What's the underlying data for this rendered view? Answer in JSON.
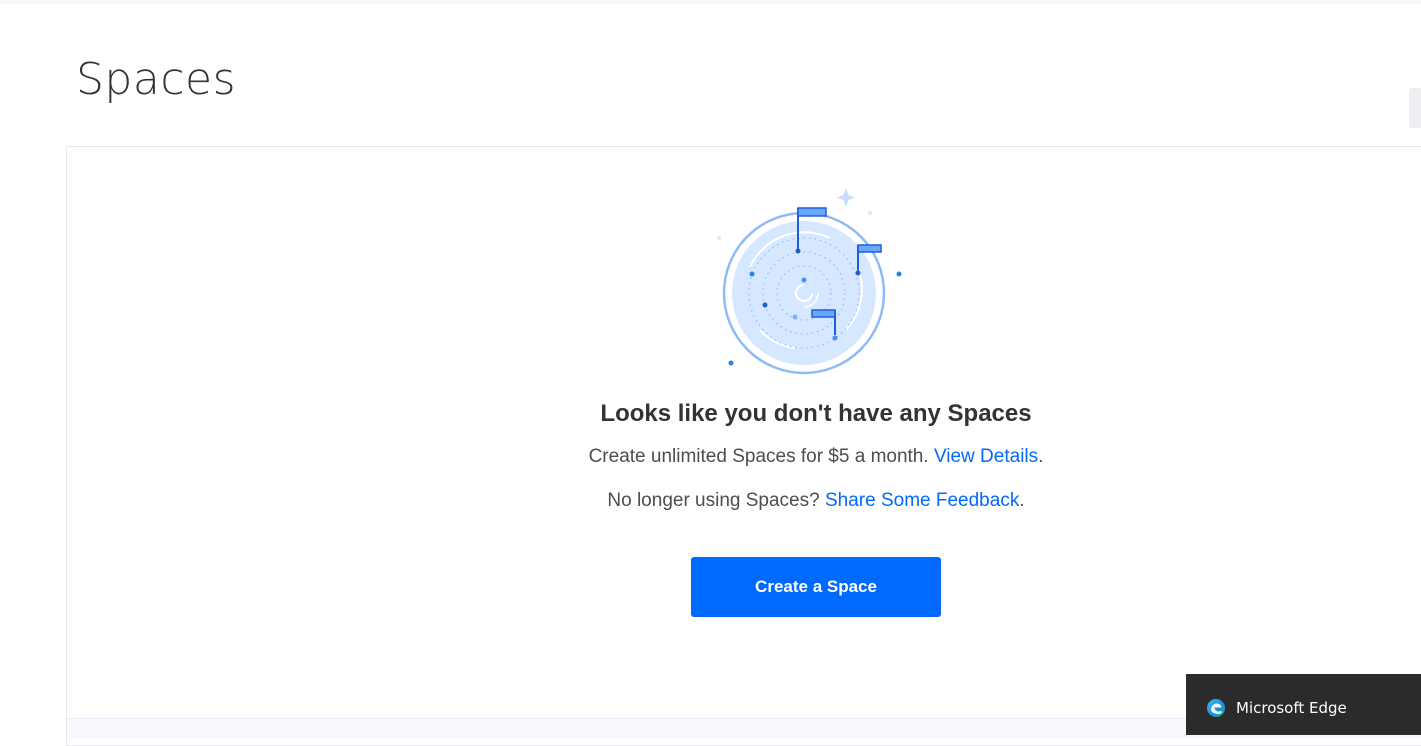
{
  "page": {
    "title": "Spaces"
  },
  "empty_state": {
    "illustration_icon": "radar-flags-icon",
    "heading": "Looks like you don't have any Spaces",
    "line1_text": "Create unlimited Spaces for $5 a month.",
    "line1_link": "View Details",
    "line1_suffix": ".",
    "line2_text": "No longer using Spaces?",
    "line2_link": "Share Some Feedback",
    "line2_suffix": ".",
    "create_button_label": "Create a Space"
  },
  "toast": {
    "icon": "edge-icon",
    "label": "Microsoft Edge"
  },
  "colors": {
    "accent": "#0069ff",
    "text": "#333333",
    "muted_text": "#4d4d4d",
    "toast_bg": "#2b2b2b",
    "illustration_fill": "#d6e8ff",
    "illustration_stroke": "#8fbbf5"
  }
}
